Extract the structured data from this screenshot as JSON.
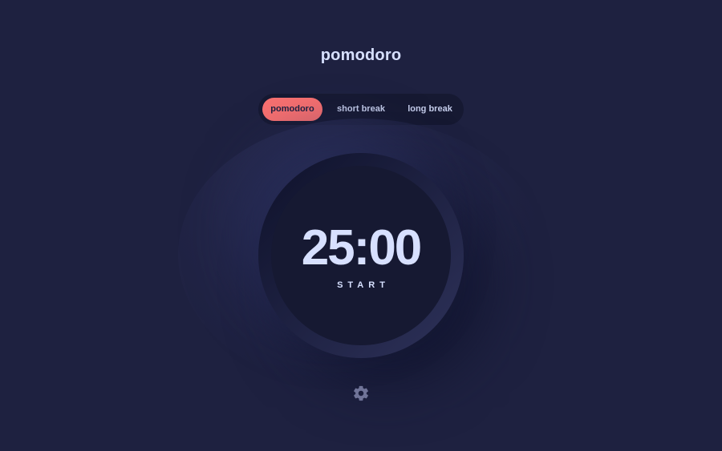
{
  "app": {
    "title": "pomodoro"
  },
  "modes": {
    "items": [
      {
        "label": "pomodoro",
        "active": true
      },
      {
        "label": "short break",
        "active": false
      },
      {
        "label": "long break",
        "active": false
      }
    ]
  },
  "timer": {
    "time": "25:00",
    "action_label": "START"
  },
  "settings": {
    "icon": "gear-icon"
  },
  "colors": {
    "background": "#1e2140",
    "panel": "#161932",
    "accent": "#f87070",
    "text": "#d7e0ff",
    "icon": "#707498"
  }
}
